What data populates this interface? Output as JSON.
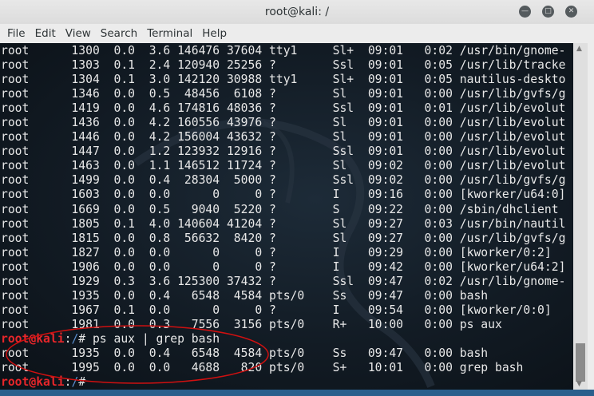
{
  "window": {
    "title": "root@kali: /"
  },
  "menu": [
    "File",
    "Edit",
    "View",
    "Search",
    "Terminal",
    "Help"
  ],
  "terminal": {
    "lines": [
      "root      1300  0.0  3.6 146476 37604 tty1     Sl+  09:01   0:02 /usr/bin/gnome-",
      "root      1303  0.1  2.4 120940 25256 ?        Ssl  09:01   0:05 /usr/lib/tracke",
      "root      1304  0.1  3.0 142120 30988 tty1     Sl+  09:01   0:05 nautilus-deskto",
      "root      1346  0.0  0.5  48456  6108 ?        Sl   09:01   0:00 /usr/lib/gvfs/g",
      "root      1419  0.0  4.6 174816 48036 ?        Ssl  09:01   0:01 /usr/lib/evolut",
      "root      1436  0.0  4.2 160556 43976 ?        Sl   09:01   0:00 /usr/lib/evolut",
      "root      1446  0.0  4.2 156004 43632 ?        Sl   09:01   0:00 /usr/lib/evolut",
      "root      1447  0.0  1.2 123932 12916 ?        Ssl  09:01   0:00 /usr/lib/evolut",
      "root      1463  0.0  1.1 146512 11724 ?        Sl   09:02   0:00 /usr/lib/evolut",
      "root      1499  0.0  0.4  28304  5000 ?        Ssl  09:02   0:00 /usr/lib/gvfs/g",
      "root      1603  0.0  0.0      0     0 ?        I    09:16   0:00 [kworker/u64:0]",
      "root      1669  0.0  0.5   9040  5220 ?        S    09:22   0:00 /sbin/dhclient",
      "root      1805  0.1  4.0 140604 41204 ?        Sl   09:27   0:03 /usr/bin/nautil",
      "root      1815  0.0  0.8  56632  8420 ?        Sl   09:27   0:00 /usr/lib/gvfs/g",
      "root      1827  0.0  0.0      0     0 ?        I    09:29   0:00 [kworker/0:2]",
      "root      1906  0.0  0.0      0     0 ?        I    09:42   0:00 [kworker/u64:2]",
      "root      1929  0.3  3.6 125300 37432 ?        Ssl  09:47   0:02 /usr/lib/gnome-",
      "root      1935  0.0  0.4   6548  4584 pts/0    Ss   09:47   0:00 bash",
      "root      1967  0.1  0.0      0     0 ?        I    09:54   0:00 [kworker/0:0]",
      "root      1981  0.0  0.3   7556  3156 pts/0    R+   10:00   0:00 ps aux",
      {
        "user": "root@kali",
        "sep": ":",
        "path": "/",
        "cmd": "# ps aux | grep bash"
      },
      "root      1935  0.0  0.4   6548  4584 pts/0    Ss   09:47   0:00 bash",
      "root      1995  0.0  0.0   4688   820 pts/0    S+   10:01   0:00 grep bash",
      {
        "user": "root@kali",
        "sep": ":",
        "path": "/",
        "cmd": "#"
      }
    ]
  },
  "colors": {
    "prompt_user": "#e8262a",
    "prompt_path": "#5a8fd0",
    "annotation": "#d01010"
  }
}
